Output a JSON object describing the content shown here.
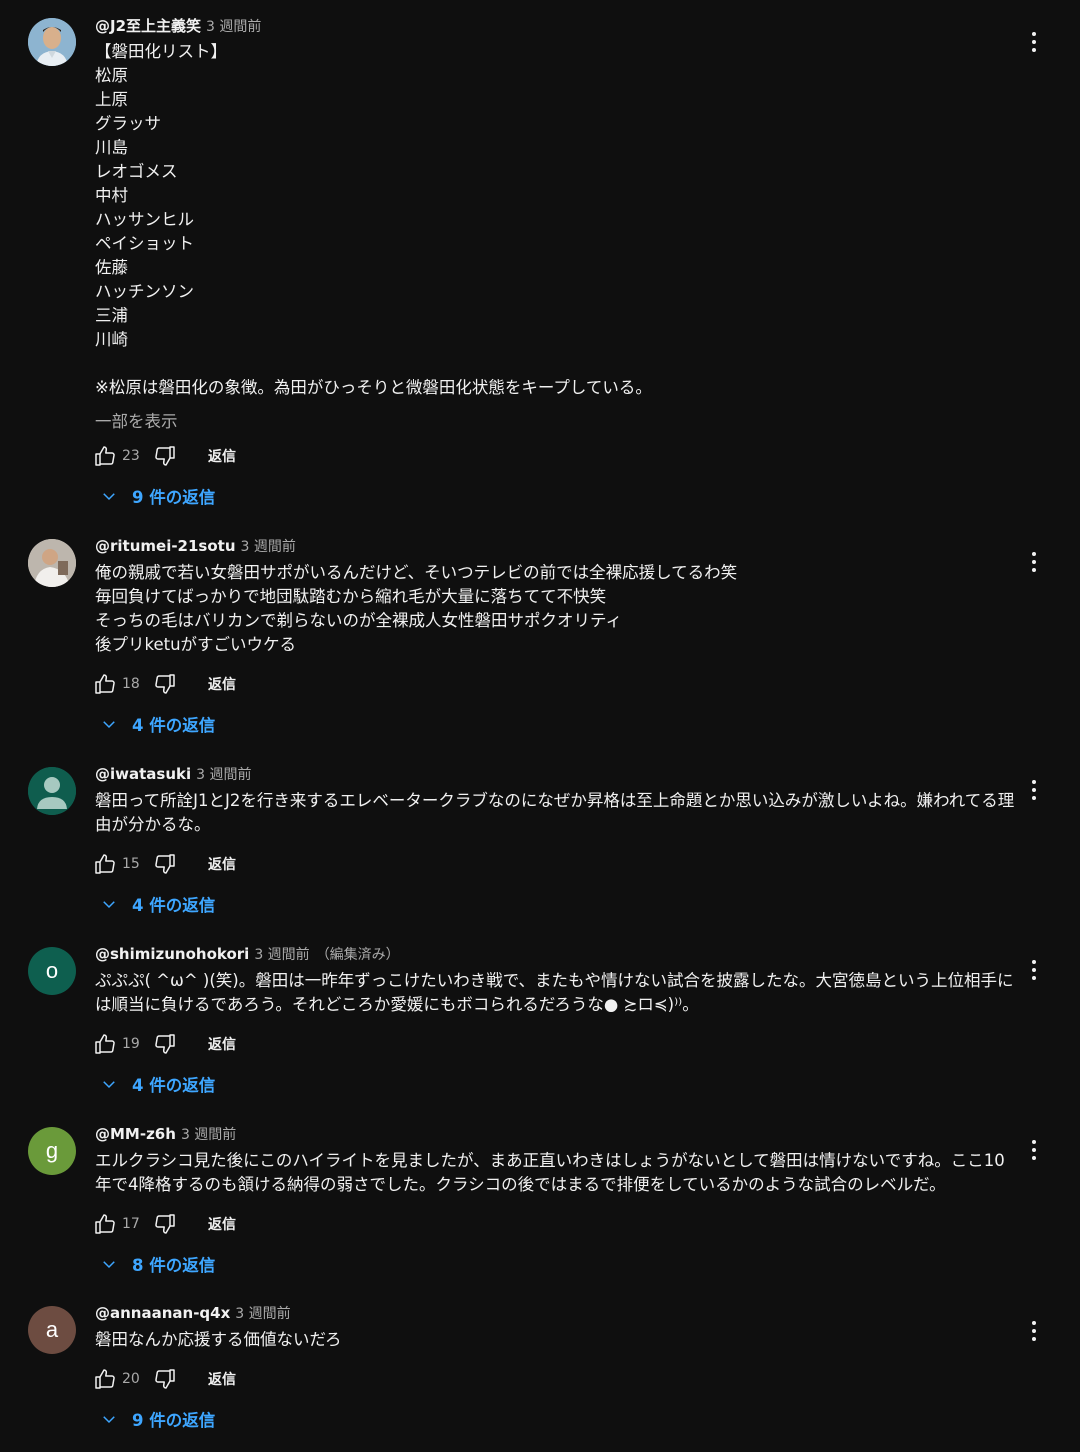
{
  "comments": [
    {
      "author": "@J2至上主義笑",
      "time": "3 週間前",
      "edited": "",
      "avatar_letter": "",
      "avatar_color": "#7aa7c7",
      "text": "【磐田化リスト】\n松原\n上原\nグラッサ\n川島\nレオゴメス\n中村\nハッサンヒル\nペイショット\n佐藤\nハッチンソン\n三浦\n川崎\n\n※松原は磐田化の象徴。為田がひっそりと微磐田化状態をキープしている。",
      "show_more": "一部を表示",
      "likes": "23",
      "reply_label": "返信",
      "replies": "9 件の返信"
    },
    {
      "author": "@ritumei-21sotu",
      "time": "3 週間前",
      "edited": "",
      "avatar_letter": "",
      "avatar_color": "#c9c0b6",
      "text": "俺の親戚で若い女磐田サポがいるんだけど、そいつテレビの前では全裸応援してるわ笑\n毎回負けてばっかりで地団駄踏むから縮れ毛が大量に落ちてて不快笑\nそっちの毛はバリカンで剃らないのが全裸成人女性磐田サポクオリティ\n後プリketuがすごいウケる",
      "likes": "18",
      "reply_label": "返信",
      "replies": "4 件の返信"
    },
    {
      "author": "@iwatasuki",
      "time": "3 週間前",
      "edited": "",
      "avatar_letter": "",
      "avatar_color": "#0f5d4e",
      "text": "磐田って所詮J1とJ2を行き来するエレベータークラブなのになぜか昇格は至上命題とか思い込みが激しいよね。嫌われてる理由が分かるな。",
      "likes": "15",
      "reply_label": "返信",
      "replies": "4 件の返信"
    },
    {
      "author": "@shimizunohokori",
      "time": "3 週間前",
      "edited": "（編集済み）",
      "avatar_letter": "o",
      "avatar_color": "#0e5f4f",
      "text": "ぷぷぷ( ^ω^ )(笑)。磐田は一昨年ずっこけたいわき戦で、またもや情けない試合を披露したな。大宮徳島という上位相手には順当に負けるであろう。それどころか愛媛にもボコられるだろうな● ≿ロ≼)⁾⁾。",
      "likes": "19",
      "reply_label": "返信",
      "replies": "4 件の返信"
    },
    {
      "author": "@MM-z6h",
      "time": "3 週間前",
      "edited": "",
      "avatar_letter": "g",
      "avatar_color": "#6a9a3a",
      "text": "エルクラシコ見た後にこのハイライトを見ましたが、まあ正直いわきはしょうがないとして磐田は情けないですね。ここ10年で4降格するのも頷ける納得の弱さでした。クラシコの後ではまるで排便をしているかのような試合のレベルだ。",
      "likes": "17",
      "reply_label": "返信",
      "replies": "8 件の返信"
    },
    {
      "author": "@annaanan-q4x",
      "time": "3 週間前",
      "edited": "",
      "avatar_letter": "a",
      "avatar_color": "#6d4c41",
      "text": "磐田なんか応援する価値ないだろ",
      "likes": "20",
      "reply_label": "返信",
      "replies": "9 件の返信"
    }
  ]
}
